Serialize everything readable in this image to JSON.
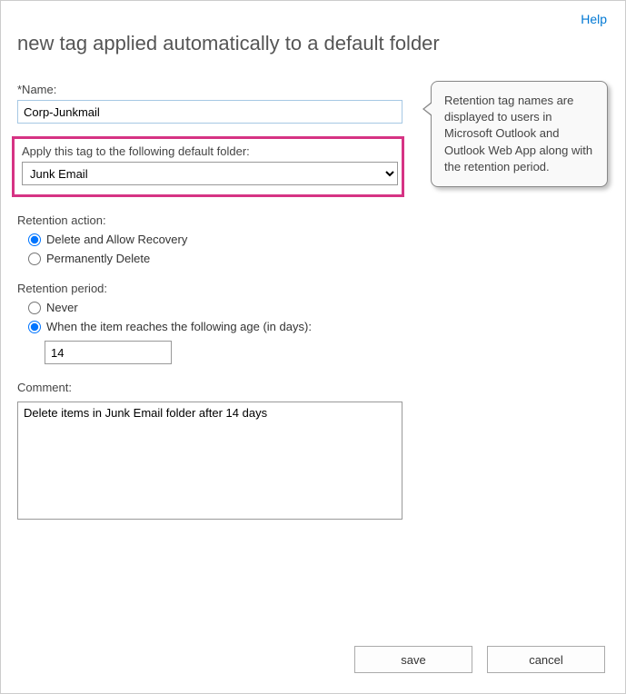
{
  "help_label": "Help",
  "page_title": "new tag applied automatically to a default folder",
  "name": {
    "label": "*Name:",
    "value": "Corp-Junkmail"
  },
  "tooltip": "Retention tag names are displayed to users in Microsoft Outlook and Outlook Web App along with the retention period.",
  "folder": {
    "label": "Apply this tag to the following default folder:",
    "selected": "Junk Email"
  },
  "retention_action": {
    "label": "Retention action:",
    "options": {
      "delete_allow_recovery": "Delete and Allow Recovery",
      "permanently_delete": "Permanently Delete"
    },
    "selected": "delete_allow_recovery"
  },
  "retention_period": {
    "label": "Retention period:",
    "options": {
      "never": "Never",
      "when_age": "When the item reaches the following age (in days):"
    },
    "selected": "when_age",
    "days_value": "14"
  },
  "comment": {
    "label": "Comment:",
    "value": "Delete items in Junk Email folder after 14 days"
  },
  "buttons": {
    "save": "save",
    "cancel": "cancel"
  }
}
